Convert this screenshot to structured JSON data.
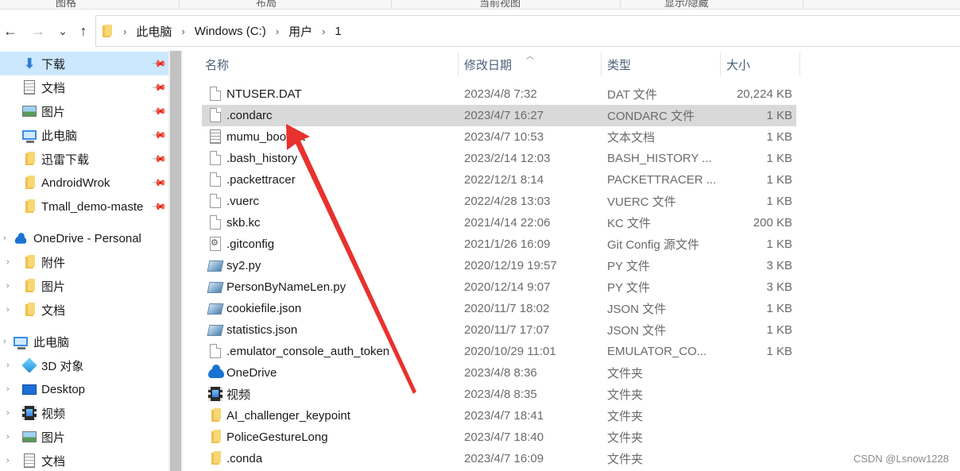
{
  "ribbon": {
    "groups": [
      "图格",
      "布局",
      "当前视图",
      "显示/隐藏"
    ]
  },
  "nav_buttons": {
    "back": "←",
    "forward": "→",
    "recent": "⌄",
    "up": "↑"
  },
  "address": {
    "segments": [
      "此电脑",
      "Windows (C:)",
      "用户",
      "1"
    ]
  },
  "navpane": {
    "quick_access": [
      {
        "label": "下载",
        "icon": "download-icon",
        "pinned": true,
        "selected": true
      },
      {
        "label": "文档",
        "icon": "documents-icon",
        "pinned": true
      },
      {
        "label": "图片",
        "icon": "pictures-icon",
        "pinned": true
      },
      {
        "label": "此电脑",
        "icon": "computer-icon",
        "pinned": true
      },
      {
        "label": "迅雷下载",
        "icon": "folder-icon",
        "pinned": true
      },
      {
        "label": "AndroidWrok",
        "icon": "folder-icon",
        "pinned": true
      },
      {
        "label": "Tmall_demo-maste",
        "icon": "folder-icon",
        "pinned": true
      }
    ],
    "onedrive": {
      "label": "OneDrive - Personal",
      "children": [
        "附件",
        "图片",
        "文档"
      ]
    },
    "this_pc": {
      "label": "此电脑",
      "children": [
        {
          "label": "3D 对象",
          "icon": "3d-objects-icon"
        },
        {
          "label": "Desktop",
          "icon": "desktop-icon"
        },
        {
          "label": "视频",
          "icon": "videos-icon"
        },
        {
          "label": "图片",
          "icon": "pictures-icon"
        },
        {
          "label": "文档",
          "icon": "documents-icon"
        }
      ]
    }
  },
  "columns": {
    "name": "名称",
    "date": "修改日期",
    "type": "类型",
    "size": "大小"
  },
  "files": [
    {
      "name": "NTUSER.DAT",
      "date": "2023/4/8 7:32",
      "type": "DAT 文件",
      "size": "20,224 KB",
      "icon": "file-icon"
    },
    {
      "name": ".condarc",
      "date": "2023/4/7 16:27",
      "type": "CONDARC 文件",
      "size": "1 KB",
      "icon": "file-icon",
      "selected": true
    },
    {
      "name": "mumu_boot.txt",
      "date": "2023/4/7 10:53",
      "type": "文本文档",
      "size": "1 KB",
      "icon": "text-file-icon"
    },
    {
      "name": ".bash_history",
      "date": "2023/2/14 12:03",
      "type": "BASH_HISTORY ...",
      "size": "1 KB",
      "icon": "file-icon"
    },
    {
      "name": ".packettracer",
      "date": "2022/12/1 8:14",
      "type": "PACKETTRACER ...",
      "size": "1 KB",
      "icon": "file-icon"
    },
    {
      "name": ".vuerc",
      "date": "2022/4/28 13:03",
      "type": "VUERC 文件",
      "size": "1 KB",
      "icon": "file-icon"
    },
    {
      "name": "skb.kc",
      "date": "2021/4/14 22:06",
      "type": "KC 文件",
      "size": "200 KB",
      "icon": "file-icon"
    },
    {
      "name": ".gitconfig",
      "date": "2021/1/26 16:09",
      "type": "Git Config 源文件",
      "size": "1 KB",
      "icon": "config-file-icon"
    },
    {
      "name": "sy2.py",
      "date": "2020/12/19 19:57",
      "type": "PY 文件",
      "size": "3 KB",
      "icon": "python-file-icon"
    },
    {
      "name": "PersonByNameLen.py",
      "date": "2020/12/14 9:07",
      "type": "PY 文件",
      "size": "3 KB",
      "icon": "python-file-icon"
    },
    {
      "name": "cookiefile.json",
      "date": "2020/11/7 18:02",
      "type": "JSON 文件",
      "size": "1 KB",
      "icon": "python-file-icon"
    },
    {
      "name": "statistics.json",
      "date": "2020/11/7 17:07",
      "type": "JSON 文件",
      "size": "1 KB",
      "icon": "python-file-icon"
    },
    {
      "name": ".emulator_console_auth_token",
      "date": "2020/10/29 11:01",
      "type": "EMULATOR_CO...",
      "size": "1 KB",
      "icon": "file-icon"
    },
    {
      "name": "OneDrive",
      "date": "2023/4/8 8:36",
      "type": "文件夹",
      "size": "",
      "icon": "onedrive-icon"
    },
    {
      "name": "视频",
      "date": "2023/4/8 8:35",
      "type": "文件夹",
      "size": "",
      "icon": "videos-icon"
    },
    {
      "name": "AI_challenger_keypoint",
      "date": "2023/4/7 18:41",
      "type": "文件夹",
      "size": "",
      "icon": "folder-icon"
    },
    {
      "name": "PoliceGestureLong",
      "date": "2023/4/7 18:40",
      "type": "文件夹",
      "size": "",
      "icon": "folder-icon"
    },
    {
      "name": ".conda",
      "date": "2023/4/7 16:09",
      "type": "文件夹",
      "size": "",
      "icon": "folder-icon"
    }
  ],
  "annotation": {
    "color": "#e8322e"
  },
  "watermark": "CSDN @Lsnow1228"
}
